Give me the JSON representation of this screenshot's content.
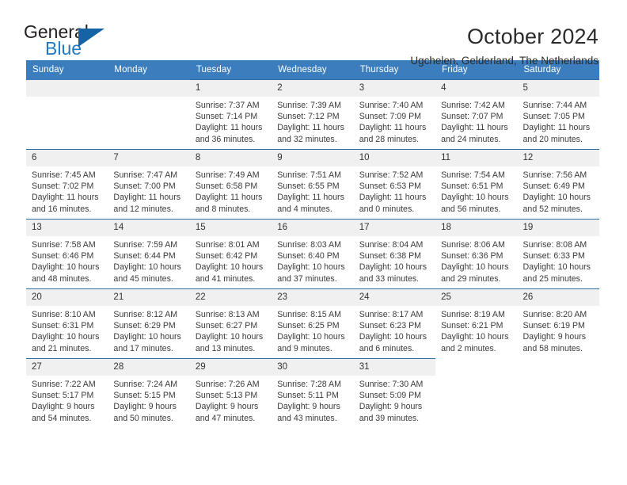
{
  "brand": {
    "name_top": "General",
    "name_bottom": "Blue",
    "triangle_color": "#1464a5",
    "blue_color": "#1f7ac1"
  },
  "header": {
    "title": "October 2024",
    "subtitle": "Ugchelen, Gelderland, The Netherlands"
  },
  "theme": {
    "header_bar": "#3b7dbd",
    "row_rule": "#2a6ca8",
    "daynum_band": "#f0f0f0"
  },
  "weekday_headers": [
    "Sunday",
    "Monday",
    "Tuesday",
    "Wednesday",
    "Thursday",
    "Friday",
    "Saturday"
  ],
  "labels": {
    "sunrise_prefix": "Sunrise: ",
    "sunset_prefix": "Sunset: ",
    "daylight_prefix": "Daylight: "
  },
  "weeks": [
    [
      {
        "day": "",
        "blank": true
      },
      {
        "day": "",
        "blank": true
      },
      {
        "day": "1",
        "sunrise": "Sunrise: 7:37 AM",
        "sunset": "Sunset: 7:14 PM",
        "daylight_1": "Daylight: 11 hours",
        "daylight_2": "and 36 minutes."
      },
      {
        "day": "2",
        "sunrise": "Sunrise: 7:39 AM",
        "sunset": "Sunset: 7:12 PM",
        "daylight_1": "Daylight: 11 hours",
        "daylight_2": "and 32 minutes."
      },
      {
        "day": "3",
        "sunrise": "Sunrise: 7:40 AM",
        "sunset": "Sunset: 7:09 PM",
        "daylight_1": "Daylight: 11 hours",
        "daylight_2": "and 28 minutes."
      },
      {
        "day": "4",
        "sunrise": "Sunrise: 7:42 AM",
        "sunset": "Sunset: 7:07 PM",
        "daylight_1": "Daylight: 11 hours",
        "daylight_2": "and 24 minutes."
      },
      {
        "day": "5",
        "sunrise": "Sunrise: 7:44 AM",
        "sunset": "Sunset: 7:05 PM",
        "daylight_1": "Daylight: 11 hours",
        "daylight_2": "and 20 minutes."
      }
    ],
    [
      {
        "day": "6",
        "sunrise": "Sunrise: 7:45 AM",
        "sunset": "Sunset: 7:02 PM",
        "daylight_1": "Daylight: 11 hours",
        "daylight_2": "and 16 minutes."
      },
      {
        "day": "7",
        "sunrise": "Sunrise: 7:47 AM",
        "sunset": "Sunset: 7:00 PM",
        "daylight_1": "Daylight: 11 hours",
        "daylight_2": "and 12 minutes."
      },
      {
        "day": "8",
        "sunrise": "Sunrise: 7:49 AM",
        "sunset": "Sunset: 6:58 PM",
        "daylight_1": "Daylight: 11 hours",
        "daylight_2": "and 8 minutes."
      },
      {
        "day": "9",
        "sunrise": "Sunrise: 7:51 AM",
        "sunset": "Sunset: 6:55 PM",
        "daylight_1": "Daylight: 11 hours",
        "daylight_2": "and 4 minutes."
      },
      {
        "day": "10",
        "sunrise": "Sunrise: 7:52 AM",
        "sunset": "Sunset: 6:53 PM",
        "daylight_1": "Daylight: 11 hours",
        "daylight_2": "and 0 minutes."
      },
      {
        "day": "11",
        "sunrise": "Sunrise: 7:54 AM",
        "sunset": "Sunset: 6:51 PM",
        "daylight_1": "Daylight: 10 hours",
        "daylight_2": "and 56 minutes."
      },
      {
        "day": "12",
        "sunrise": "Sunrise: 7:56 AM",
        "sunset": "Sunset: 6:49 PM",
        "daylight_1": "Daylight: 10 hours",
        "daylight_2": "and 52 minutes."
      }
    ],
    [
      {
        "day": "13",
        "sunrise": "Sunrise: 7:58 AM",
        "sunset": "Sunset: 6:46 PM",
        "daylight_1": "Daylight: 10 hours",
        "daylight_2": "and 48 minutes."
      },
      {
        "day": "14",
        "sunrise": "Sunrise: 7:59 AM",
        "sunset": "Sunset: 6:44 PM",
        "daylight_1": "Daylight: 10 hours",
        "daylight_2": "and 45 minutes."
      },
      {
        "day": "15",
        "sunrise": "Sunrise: 8:01 AM",
        "sunset": "Sunset: 6:42 PM",
        "daylight_1": "Daylight: 10 hours",
        "daylight_2": "and 41 minutes."
      },
      {
        "day": "16",
        "sunrise": "Sunrise: 8:03 AM",
        "sunset": "Sunset: 6:40 PM",
        "daylight_1": "Daylight: 10 hours",
        "daylight_2": "and 37 minutes."
      },
      {
        "day": "17",
        "sunrise": "Sunrise: 8:04 AM",
        "sunset": "Sunset: 6:38 PM",
        "daylight_1": "Daylight: 10 hours",
        "daylight_2": "and 33 minutes."
      },
      {
        "day": "18",
        "sunrise": "Sunrise: 8:06 AM",
        "sunset": "Sunset: 6:36 PM",
        "daylight_1": "Daylight: 10 hours",
        "daylight_2": "and 29 minutes."
      },
      {
        "day": "19",
        "sunrise": "Sunrise: 8:08 AM",
        "sunset": "Sunset: 6:33 PM",
        "daylight_1": "Daylight: 10 hours",
        "daylight_2": "and 25 minutes."
      }
    ],
    [
      {
        "day": "20",
        "sunrise": "Sunrise: 8:10 AM",
        "sunset": "Sunset: 6:31 PM",
        "daylight_1": "Daylight: 10 hours",
        "daylight_2": "and 21 minutes."
      },
      {
        "day": "21",
        "sunrise": "Sunrise: 8:12 AM",
        "sunset": "Sunset: 6:29 PM",
        "daylight_1": "Daylight: 10 hours",
        "daylight_2": "and 17 minutes."
      },
      {
        "day": "22",
        "sunrise": "Sunrise: 8:13 AM",
        "sunset": "Sunset: 6:27 PM",
        "daylight_1": "Daylight: 10 hours",
        "daylight_2": "and 13 minutes."
      },
      {
        "day": "23",
        "sunrise": "Sunrise: 8:15 AM",
        "sunset": "Sunset: 6:25 PM",
        "daylight_1": "Daylight: 10 hours",
        "daylight_2": "and 9 minutes."
      },
      {
        "day": "24",
        "sunrise": "Sunrise: 8:17 AM",
        "sunset": "Sunset: 6:23 PM",
        "daylight_1": "Daylight: 10 hours",
        "daylight_2": "and 6 minutes."
      },
      {
        "day": "25",
        "sunrise": "Sunrise: 8:19 AM",
        "sunset": "Sunset: 6:21 PM",
        "daylight_1": "Daylight: 10 hours",
        "daylight_2": "and 2 minutes."
      },
      {
        "day": "26",
        "sunrise": "Sunrise: 8:20 AM",
        "sunset": "Sunset: 6:19 PM",
        "daylight_1": "Daylight: 9 hours",
        "daylight_2": "and 58 minutes."
      }
    ],
    [
      {
        "day": "27",
        "sunrise": "Sunrise: 7:22 AM",
        "sunset": "Sunset: 5:17 PM",
        "daylight_1": "Daylight: 9 hours",
        "daylight_2": "and 54 minutes."
      },
      {
        "day": "28",
        "sunrise": "Sunrise: 7:24 AM",
        "sunset": "Sunset: 5:15 PM",
        "daylight_1": "Daylight: 9 hours",
        "daylight_2": "and 50 minutes."
      },
      {
        "day": "29",
        "sunrise": "Sunrise: 7:26 AM",
        "sunset": "Sunset: 5:13 PM",
        "daylight_1": "Daylight: 9 hours",
        "daylight_2": "and 47 minutes."
      },
      {
        "day": "30",
        "sunrise": "Sunrise: 7:28 AM",
        "sunset": "Sunset: 5:11 PM",
        "daylight_1": "Daylight: 9 hours",
        "daylight_2": "and 43 minutes."
      },
      {
        "day": "31",
        "sunrise": "Sunrise: 7:30 AM",
        "sunset": "Sunset: 5:09 PM",
        "daylight_1": "Daylight: 9 hours",
        "daylight_2": "and 39 minutes."
      },
      {
        "day": "",
        "blank": true,
        "tail": true
      },
      {
        "day": "",
        "blank": true,
        "tail": true
      }
    ]
  ]
}
